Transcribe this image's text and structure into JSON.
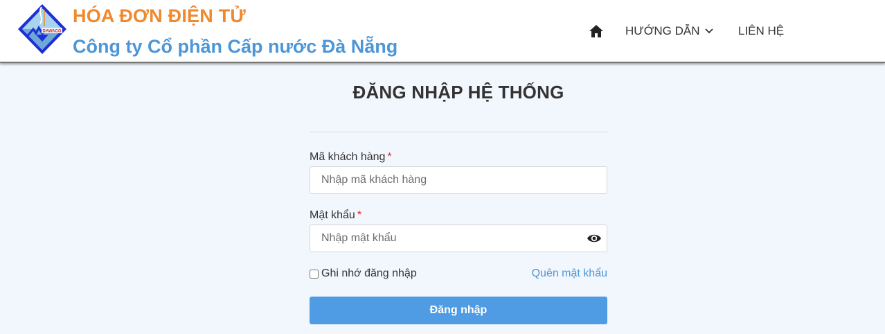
{
  "header": {
    "brand_title": "HÓA ĐƠN ĐIỆN TỬ",
    "brand_subtitle": "Công ty Cổ phần Cấp nước Đà Nẵng",
    "logo_text": "DAWACO",
    "nav": {
      "home_icon": "home-icon",
      "guide_label": "HƯỚNG DẪN",
      "guide_icon": "chevron-down-icon",
      "contact_label": "LIÊN HỆ"
    }
  },
  "login": {
    "title": "ĐĂNG NHẬP HỆ THỐNG",
    "customer_id": {
      "label": "Mã khách hàng",
      "required_mark": "*",
      "value": "",
      "placeholder": "Nhập mã khách hàng"
    },
    "password": {
      "label": "Mật khẩu",
      "required_mark": "*",
      "value": "",
      "placeholder": "Nhập mật khẩu",
      "toggle_icon": "eye-icon"
    },
    "remember_label": "Ghi nhớ đăng nhập",
    "remember_checked": false,
    "forgot_label": "Quên mật khẩu",
    "submit_label": "Đăng nhập"
  },
  "colors": {
    "brand_orange": "#f0892d",
    "brand_blue": "#4c96d7",
    "button_blue": "#4f9ce4",
    "page_background": "#f2f6fd",
    "required_red": "#e0262f"
  }
}
